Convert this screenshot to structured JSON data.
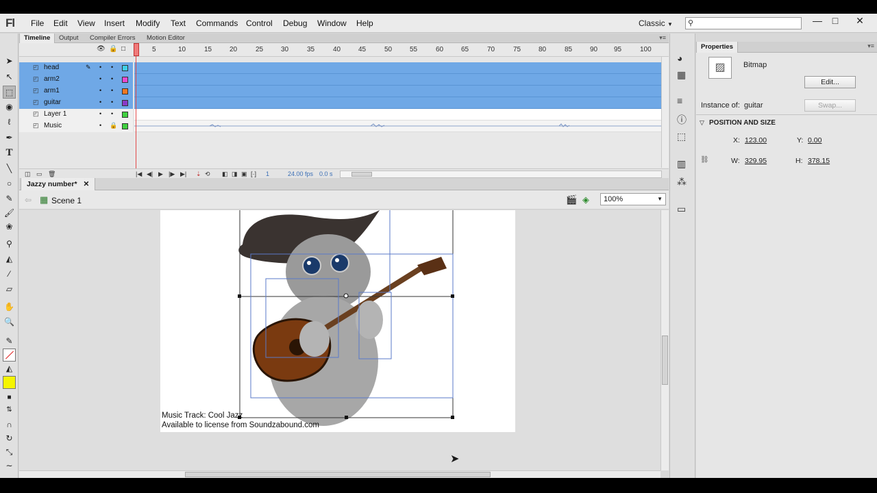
{
  "app": {
    "logo": "Fl",
    "workspace": "Classic"
  },
  "menu": [
    "File",
    "Edit",
    "View",
    "Insert",
    "Modify",
    "Text",
    "Commands",
    "Control",
    "Debug",
    "Window",
    "Help"
  ],
  "window_buttons": [
    "—",
    "□",
    "✕"
  ],
  "timeline": {
    "tabs": [
      "Timeline",
      "Output",
      "Compiler Errors",
      "Motion Editor"
    ],
    "frame_numbers": [
      "5",
      "10",
      "15",
      "20",
      "25",
      "30",
      "35",
      "40",
      "45",
      "50",
      "55",
      "60",
      "65",
      "70",
      "75",
      "80",
      "85",
      "90",
      "95",
      "100"
    ],
    "layers": [
      {
        "name": "head",
        "color": "#3fd0e8",
        "selected": true
      },
      {
        "name": "arm2",
        "color": "#e84ad0",
        "selected": false
      },
      {
        "name": "arm1",
        "color": "#f07820",
        "selected": false
      },
      {
        "name": "guitar",
        "color": "#8a3ac8",
        "selected": false
      },
      {
        "name": "Layer 1",
        "color": "#40d040",
        "selected": false
      },
      {
        "name": "Music",
        "color": "#40d040",
        "selected": false
      }
    ],
    "footer": {
      "frame": "1",
      "fps": "24.00",
      "fps_unit": "fps",
      "time": "0.0 s"
    }
  },
  "document": {
    "tab": "Jazzy number*",
    "close": "✕",
    "scene": "Scene 1",
    "zoom": "100%"
  },
  "stage": {
    "credit_line1": "Music Track: Cool Jazz",
    "credit_line2": "Available to license from Soundzabound.com"
  },
  "properties": {
    "tab": "Properties",
    "type": "Bitmap",
    "edit_button": "Edit...",
    "instance_label": "Instance of:",
    "instance_value": "guitar",
    "swap_button": "Swap...",
    "section": "POSITION AND SIZE",
    "x_label": "X:",
    "x": "123.00",
    "y_label": "Y:",
    "y": "0.00",
    "w_label": "W:",
    "w": "329.95",
    "h_label": "H:",
    "h": "378.15"
  }
}
